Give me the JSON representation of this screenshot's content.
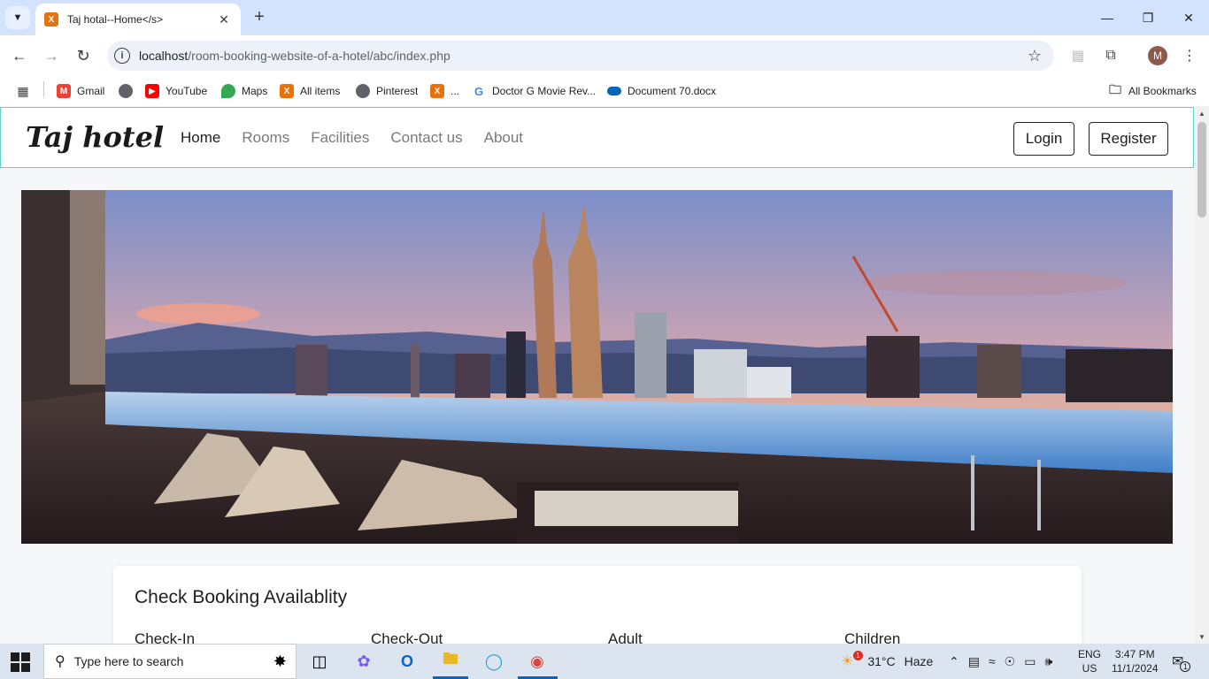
{
  "browser": {
    "tab_title": "Taj hotal--Home</s>",
    "url_host": "localhost",
    "url_path": "/room-booking-website-of-a-hotel/abc/index.php",
    "bookmarks": [
      "Gmail",
      "YouTube",
      "Maps",
      "All items",
      "Pinterest",
      "...",
      "Doctor G Movie Rev...",
      "Document 70.docx"
    ],
    "all_bookmarks": "All Bookmarks",
    "avatar_letter": "M"
  },
  "site": {
    "brand": "Taj hotel",
    "nav": [
      "Home",
      "Rooms",
      "Facilities",
      "Contact us",
      "About"
    ],
    "login": "Login",
    "register": "Register",
    "booking_title": "Check Booking Availablity",
    "fields": [
      "Check-In",
      "Check-Out",
      "Adult",
      "Children"
    ]
  },
  "taskbar": {
    "search_placeholder": "Type here to search",
    "weather_temp": "31°C",
    "weather_desc": "Haze",
    "lang": "ENG",
    "region": "US",
    "time": "3:47 PM",
    "date": "11/1/2024",
    "weather_badge": "1",
    "notif_count": "1"
  },
  "colors": {
    "navbar_border": "#5fd3c9",
    "accent": "#0067c0"
  }
}
